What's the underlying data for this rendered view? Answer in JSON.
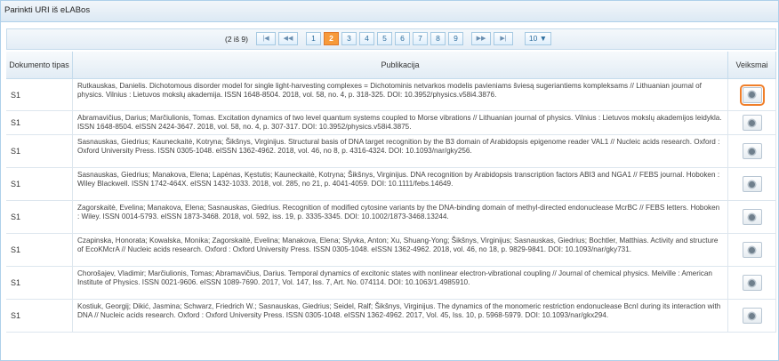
{
  "panel": {
    "title": "Parinkti URI iš eLABos"
  },
  "pager": {
    "info": "(2 iš 9)",
    "first_icon": "first-page-icon",
    "prev_icon": "prev-page-icon",
    "next_icon": "next-page-icon",
    "last_icon": "last-page-icon",
    "pages": [
      "1",
      "2",
      "3",
      "4",
      "5",
      "6",
      "7",
      "8",
      "9"
    ],
    "current_page": "2",
    "page_size": "10 ▼"
  },
  "table": {
    "headers": {
      "type": "Dokumento tipas",
      "publication": "Publikacija",
      "actions": "Veiksmai"
    },
    "rows": [
      {
        "type": "S1",
        "text": "Rutkauskas, Danielis. Dichotomous disorder model for single light-harvesting complexes = Dichotominis netvarkos modelis pavieniams šviesą sugeriantiems kompleksams // Lithuanian journal of physics. Vilnius : Lietuvos mokslų akademija. ISSN 1648-8504. 2018, vol. 58, no. 4, p. 318-325. DOI: 10.3952/physics.v58i4.3876."
      },
      {
        "type": "S1",
        "text": "Abramavičius, Darius; Marčiulionis, Tomas. Excitation dynamics of two level quantum systems coupled to Morse vibrations // Lithuanian journal of physics. Vilnius : Lietuvos mokslų akademijos leidykla. ISSN 1648-8504. eISSN 2424-3647. 2018, vol. 58, no. 4, p. 307-317. DOI: 10.3952/physics.v58i4.3875."
      },
      {
        "type": "S1",
        "text": "Sasnauskas, Giedrius; Kauneckaitė, Kotryna; Šikšnys, Virginijus. Structural basis of DNA target recognition by the B3 domain of Arabidopsis epigenome reader VAL1 // Nucleic acids research. Oxford : Oxford University Press. ISSN 0305-1048. eISSN 1362-4962. 2018, vol. 46, no 8, p. 4316-4324. DOI: 10.1093/nar/gky256."
      },
      {
        "type": "S1",
        "text": "Sasnauskas, Giedrius; Manakova, Elena; Lapėnas, Kęstutis; Kauneckaitė, Kotryna; Šikšnys, Virginijus. DNA recognition by Arabidopsis transcription factors ABI3 and NGA1 // FEBS journal. Hoboken : Wiley Blackwell. ISSN 1742-464X. eISSN 1432-1033. 2018, vol. 285, no 21, p. 4041-4059. DOI: 10.1111/febs.14649."
      },
      {
        "type": "S1",
        "text": "Zagorskaitė, Evelina; Manakova, Elena; Sasnauskas, Giedrius. Recognition of modified cytosine variants by the DNA-binding domain of methyl-directed endonuclease McrBC // FEBS letters. Hoboken : Wiley. ISSN 0014-5793. eISSN 1873-3468. 2018, vol. 592, iss. 19, p. 3335-3345. DOI: 10.1002/1873-3468.13244."
      },
      {
        "type": "S1",
        "text": "Czapinska, Honorata; Kowalska, Monika; Zagorskaitė, Evelina; Manakova, Elena; Slyvka, Anton; Xu, Shuang-Yong; Šikšnys, Virginijus; Sasnauskas, Giedrius; Bochtler, Matthias. Activity and structure of EcoKMcrA // Nucleic acids research. Oxford : Oxford University Press. ISSN 0305-1048. eISSN 1362-4962. 2018, vol. 46, no 18, p. 9829-9841. DOI: 10.1093/nar/gky731."
      },
      {
        "type": "S1",
        "text": "Chorošajev, Vladimir; Marčiulionis, Tomas; Abramavičius, Darius. Temporal dynamics of excitonic states with nonlinear electron-vibrational coupling // Journal of chemical physics. Melville : American Institute of Physics. ISSN 0021-9606. eISSN 1089-7690. 2017, Vol. 147, Iss. 7, Art. No. 074114. DOI: 10.1063/1.4985910."
      },
      {
        "type": "S1",
        "text": "Kostiuk, Georgij; Dikić, Jasmina; Schwarz, Friedrich W.; Sasnauskas, Giedrius; Seidel, Ralf; Šikšnys, Virginijus. The dynamics of the monomeric restriction endonuclease BcnI during its interaction with DNA // Nucleic acids research. Oxford : Oxford University Press. ISSN 0305-1048. eISSN 1362-4962. 2017, Vol. 45, Iss. 10, p. 5968-5979. DOI: 10.1093/nar/gkx294."
      }
    ],
    "action_icon": "settings-icon"
  }
}
